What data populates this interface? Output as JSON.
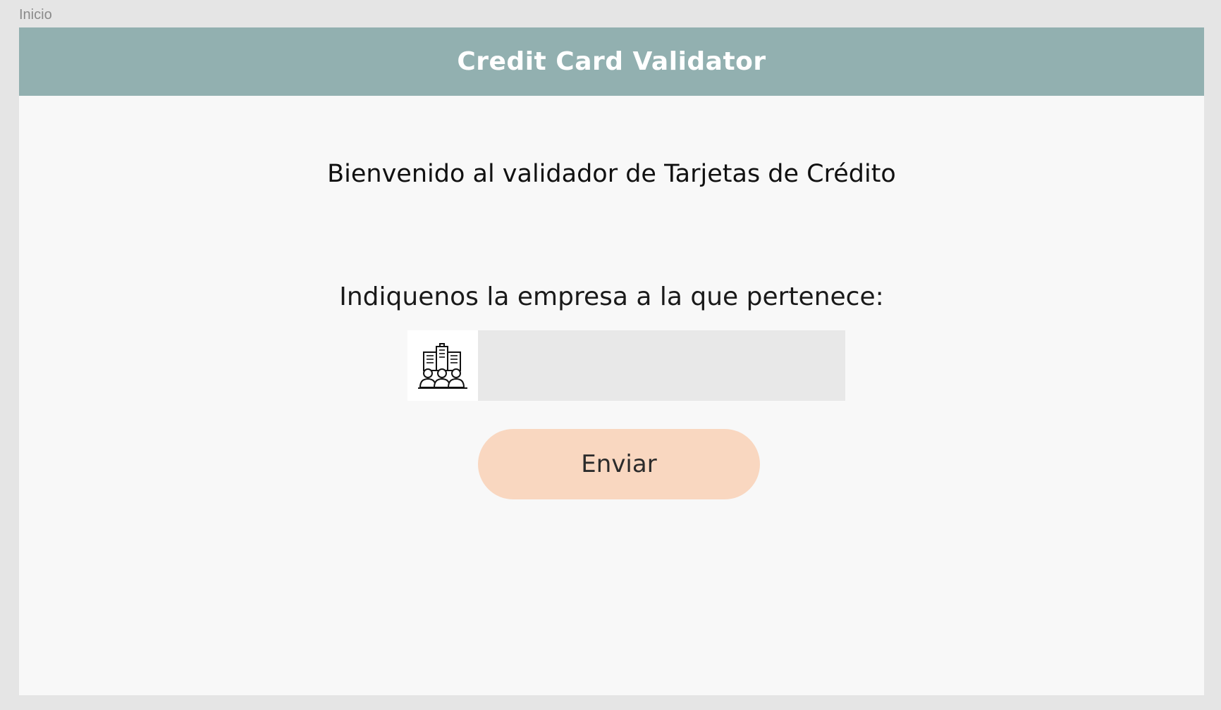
{
  "frame": {
    "label": "Inicio"
  },
  "header": {
    "title": "Credit Card Validator",
    "background": "#92b0b0"
  },
  "main": {
    "welcome": "Bienvenido al validador de Tarjetas de Crédito",
    "prompt": "Indiquenos la empresa a la que pertenece:",
    "company_field": {
      "icon": "company-building-people-icon",
      "value": "",
      "placeholder": ""
    },
    "submit": {
      "label": "Enviar",
      "color": "#f9d7c0"
    }
  }
}
